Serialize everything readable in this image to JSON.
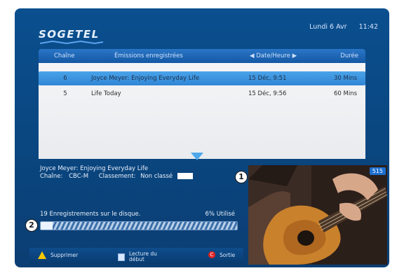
{
  "brand": {
    "name": "SOGETEL"
  },
  "header": {
    "date": "Lundi 6 Avr",
    "time": "11:42"
  },
  "columns": {
    "channel": "Chaîne",
    "recordings": "Émissions enregistrées",
    "date_time": "◀ Date/Heure ▶",
    "duration": "Durée"
  },
  "rows": [
    {
      "num": "6",
      "title": "Joyce Meyer: Enjoying Everyday Life",
      "date": "15 Déc, 9:51",
      "duration": "30 Mins",
      "selected": true
    },
    {
      "num": "5",
      "title": "Life Today",
      "date": "15 Déc, 9:56",
      "duration": "60 Mins",
      "selected": false
    }
  ],
  "info": {
    "title": "Joyce Meyer: Enjoying Everyday Life",
    "channel_label": "Chaîne:",
    "channel_value": "CBC-M",
    "class_label": "Classement:",
    "class_value": "Non classé"
  },
  "storage": {
    "recordings_text": "19 Enregistrements sur le disque.",
    "used_text": "6% Utilisé",
    "used_fraction": 0.06
  },
  "footer": {
    "delete": "Supprimer",
    "play_start_1": "Lecture du",
    "play_start_2": "début",
    "exit": "Sortie"
  },
  "video": {
    "channel_number": "515"
  },
  "callouts": {
    "one": "1",
    "two": "2"
  },
  "colors": {
    "accent": "#2f86d6",
    "background": "#0b4f8f"
  }
}
